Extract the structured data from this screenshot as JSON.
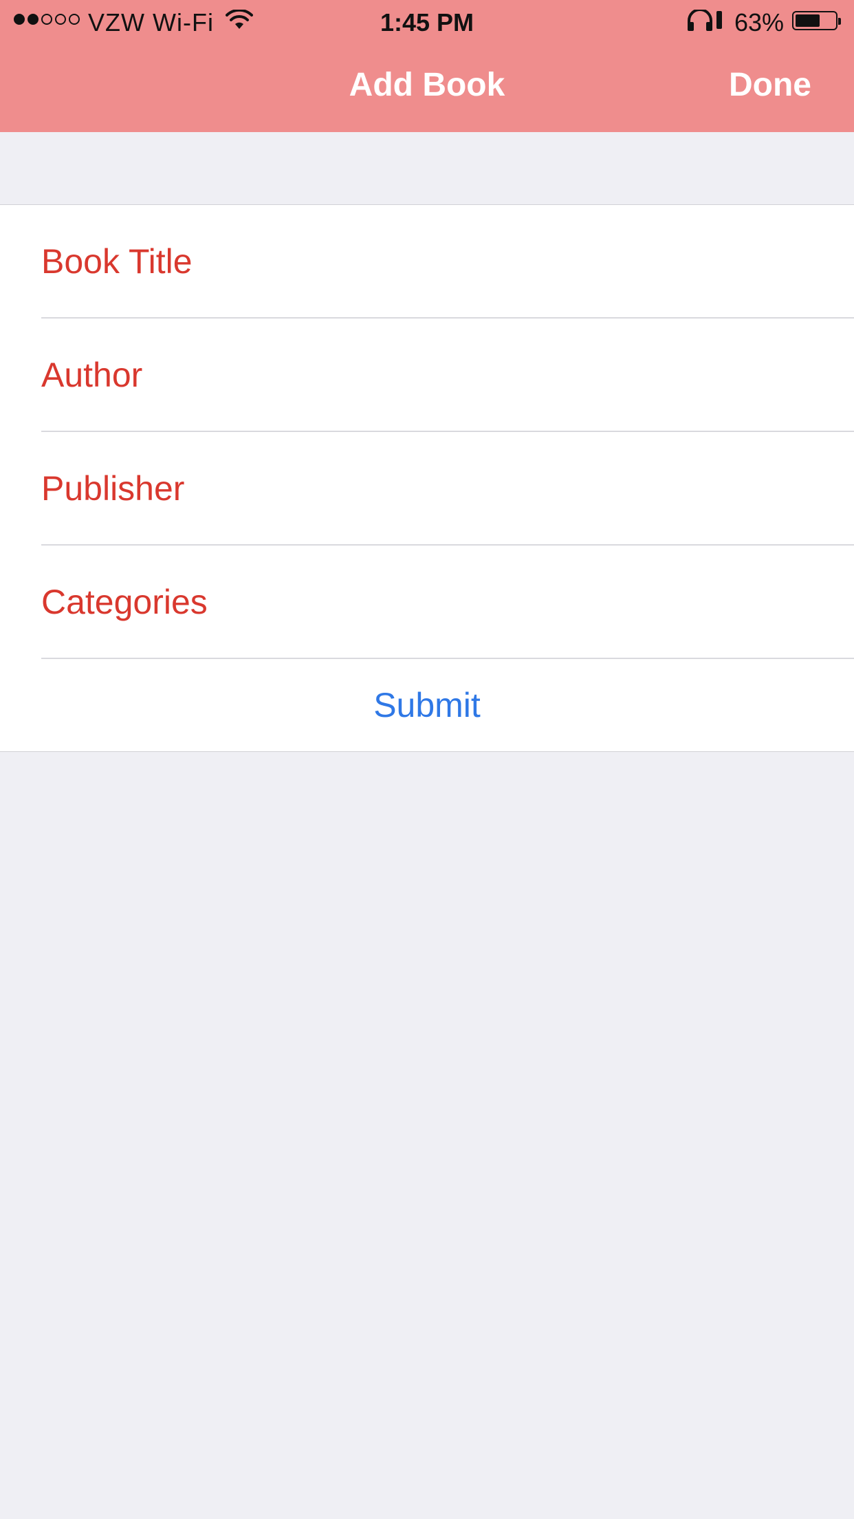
{
  "status_bar": {
    "carrier": "VZW Wi-Fi",
    "time": "1:45 PM",
    "battery_percent": "63%",
    "battery_level": 0.63,
    "signal_strength": 2,
    "icons": [
      "wifi-icon",
      "headphones-icon",
      "battery-icon"
    ]
  },
  "nav": {
    "title": "Add Book",
    "done_label": "Done"
  },
  "form": {
    "fields": [
      {
        "placeholder": "Book Title",
        "value": ""
      },
      {
        "placeholder": "Author",
        "value": ""
      },
      {
        "placeholder": "Publisher",
        "value": ""
      },
      {
        "placeholder": "Categories",
        "value": ""
      }
    ],
    "submit_label": "Submit"
  },
  "colors": {
    "nav_background": "#ef8d8d",
    "field_text": "#d9382e",
    "submit_text": "#2f78e6",
    "page_background": "#efeff4"
  }
}
